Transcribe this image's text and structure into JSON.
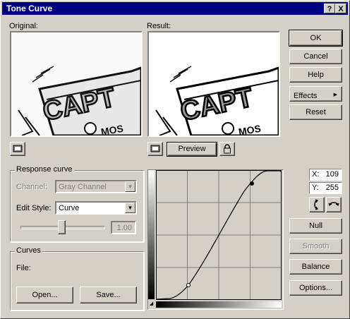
{
  "window": {
    "title": "Tone Curve",
    "help_label": "?",
    "close_label": "X"
  },
  "previews": {
    "original_label": "Original:",
    "result_label": "Result:",
    "preview_button": "Preview"
  },
  "buttons": {
    "ok": "OK",
    "cancel": "Cancel",
    "help": "Help",
    "effects": "Effects",
    "reset": "Reset",
    "null": "Null",
    "smooth": "Smooth",
    "balance": "Balance",
    "options": "Options..."
  },
  "response_curve": {
    "group_label": "Response curve",
    "channel_label": "Channel:",
    "channel_value": "Gray Channel",
    "edit_style_label": "Edit Style:",
    "edit_style_value": "Curve",
    "tension_value": "1.00",
    "tension_level": 0.5
  },
  "curves": {
    "group_label": "Curves",
    "file_label": "File:",
    "open_button": "Open...",
    "save_button": "Save..."
  },
  "coords": {
    "x_label": "X:",
    "x_value": "109",
    "y_label": "Y:",
    "y_value": "255"
  },
  "icons": {
    "effects_arrow": "right-arrow-icon",
    "lock": "lock-icon",
    "monitor": "monitor-icon",
    "swap_vertical": "swap-vertical-icon",
    "swap_horizontal": "swap-horizontal-icon"
  },
  "colors": {
    "titlebar": "#000080",
    "face": "#d4d0c8"
  }
}
